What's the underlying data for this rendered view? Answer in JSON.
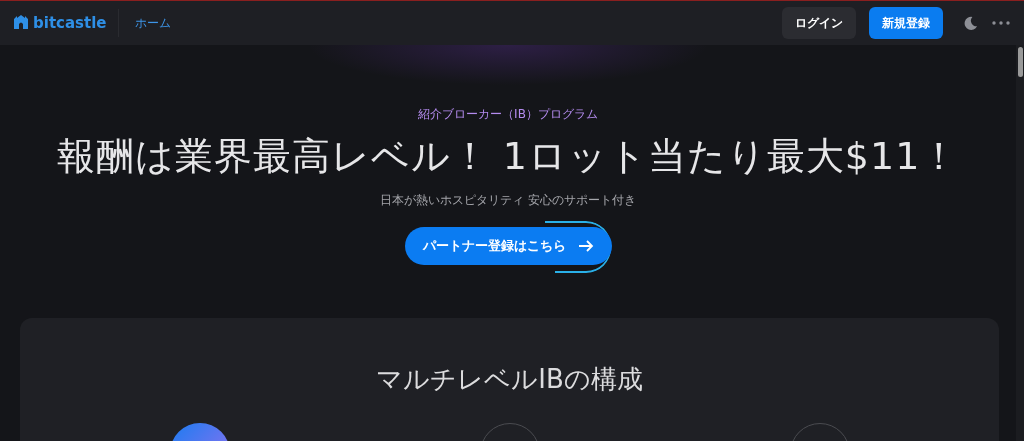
{
  "header": {
    "logo": "bitcastle",
    "nav": [
      {
        "label": "ホーム"
      }
    ],
    "login": "ログイン",
    "register": "新規登録"
  },
  "hero": {
    "eyebrow": "紹介ブローカー（IB）プログラム",
    "headline": "報酬は業界最高レベル！ 1ロット当たり最大$11！",
    "subtitle": "日本が熱いホスピタリティ 安心のサポート付き",
    "cta": "パートナー登録はこちら"
  },
  "section": {
    "title": "マルチレベルIBの構成",
    "steps": [
      {
        "selected": true
      },
      {
        "selected": false
      },
      {
        "selected": false
      }
    ]
  }
}
